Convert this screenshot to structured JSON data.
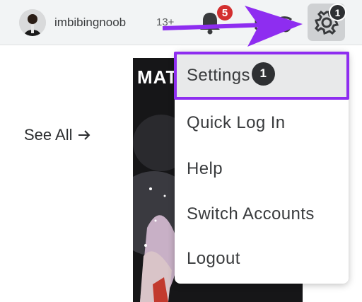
{
  "header": {
    "username": "imbibingnoob",
    "age_tag": "13+",
    "notification_count": "5",
    "settings_badge": "1"
  },
  "main": {
    "see_all_label": "See All",
    "banner_text": "MAT"
  },
  "settings_menu": {
    "items": [
      {
        "label": "Settings",
        "badge": "1"
      },
      {
        "label": "Quick Log In"
      },
      {
        "label": "Help"
      },
      {
        "label": "Switch Accounts"
      },
      {
        "label": "Logout"
      }
    ]
  },
  "colors": {
    "highlight": "#8e2df0",
    "notification_badge": "#d32f2f",
    "dark_badge": "#2e3033"
  },
  "icons": [
    "avatar",
    "bell-icon",
    "robux-icon",
    "gear-icon",
    "arrow-right-icon"
  ]
}
